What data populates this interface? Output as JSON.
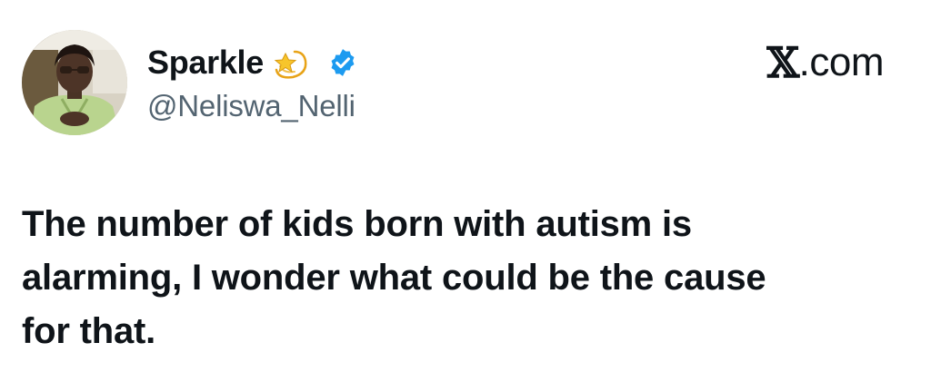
{
  "author": {
    "display_name": "Sparkle",
    "handle": "@Neliswa_Nelli",
    "emoji_icon": "dizzy-star-icon",
    "verified_icon": "verified-badge-icon",
    "verified_color": "#1d9bf0"
  },
  "brand": {
    "x_glyph": "𝕏",
    "domain": ".com"
  },
  "tweet": {
    "text": "The number of kids born with autism is\nalarming, I wonder what could be the cause\nfor that."
  },
  "colors": {
    "text": "#0f1419",
    "secondary_text": "#536471",
    "background": "#ffffff"
  }
}
